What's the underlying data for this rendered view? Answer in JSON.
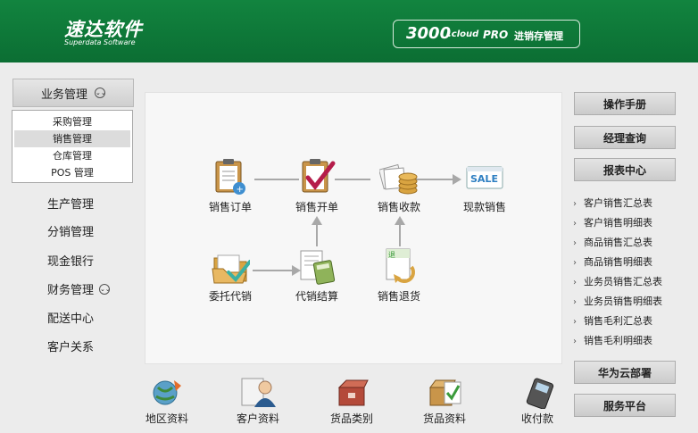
{
  "header": {
    "logo_cn": "速达软件",
    "logo_en": "Superdata Software",
    "brand_num": "3000",
    "brand_cloud": ".cloud",
    "brand_pro": "PRO",
    "brand_sub": "进销存管理"
  },
  "sidebar": {
    "header_label": "业务管理",
    "submenu": [
      "采购管理",
      "销售管理",
      "仓库管理",
      "POS 管理"
    ],
    "submenu_active_index": 1,
    "items": [
      "生产管理",
      "分销管理",
      "现金银行",
      "财务管理",
      "配送中心",
      "客户关系"
    ]
  },
  "flow": {
    "sales_order": "销售订单",
    "sales_invoice": "销售开单",
    "sales_receipt": "销售收款",
    "cash_sale": "现款销售",
    "consignment": "委托代销",
    "consign_settle": "代销结算",
    "sales_return": "销售退货",
    "sale_badge": "SALE"
  },
  "bottom": [
    "地区资料",
    "客户资料",
    "货品类别",
    "货品资料",
    "收付款"
  ],
  "right": {
    "manual": "操作手册",
    "manager_query": "经理查询",
    "report_center": "报表中心",
    "reports": [
      "客户销售汇总表",
      "客户销售明细表",
      "商品销售汇总表",
      "商品销售明细表",
      "业务员销售汇总表",
      "业务员销售明细表",
      "销售毛利汇总表",
      "销售毛利明细表"
    ],
    "huawei": "华为云部署",
    "service": "服务平台"
  },
  "colors": {
    "header_green": "#0f7a3a",
    "icon_gold": "#d9a441",
    "icon_green": "#3b9b3b"
  }
}
